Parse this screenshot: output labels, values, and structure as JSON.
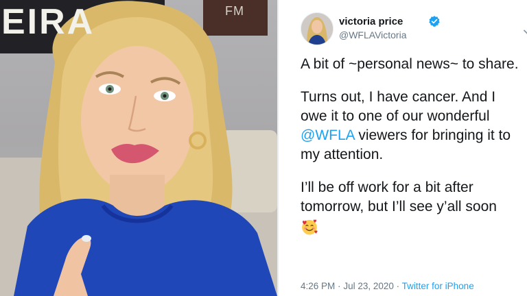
{
  "photo": {
    "wall_text_large": "EIRA",
    "wall_text_small": "FM"
  },
  "tweet": {
    "user": {
      "name": "victoria price",
      "handle": "@WFLAVictoria",
      "verified": true,
      "avatar_icon": "profile-photo"
    },
    "menu_icon": "chevron-down-icon",
    "paragraphs": {
      "p1": "A bit of ~personal news~ to share.",
      "p2_part1": "Turns out, I have cancer. And I owe it to one of our wonderful ",
      "p2_mention": "@WFLA",
      "p2_part2": " viewers for bringing it to my attention.",
      "p3": "I’ll be off work for a bit after tomorrow, but I’ll see y’all soon",
      "p3_emoji": "smiling-face-with-hearts"
    },
    "meta": {
      "time": "4:26 PM",
      "separator": "·",
      "date": "Jul 23, 2020",
      "source": "Twitter for iPhone"
    },
    "colors": {
      "link": "#1da1f2",
      "text": "#14171a",
      "muted": "#657786"
    }
  }
}
